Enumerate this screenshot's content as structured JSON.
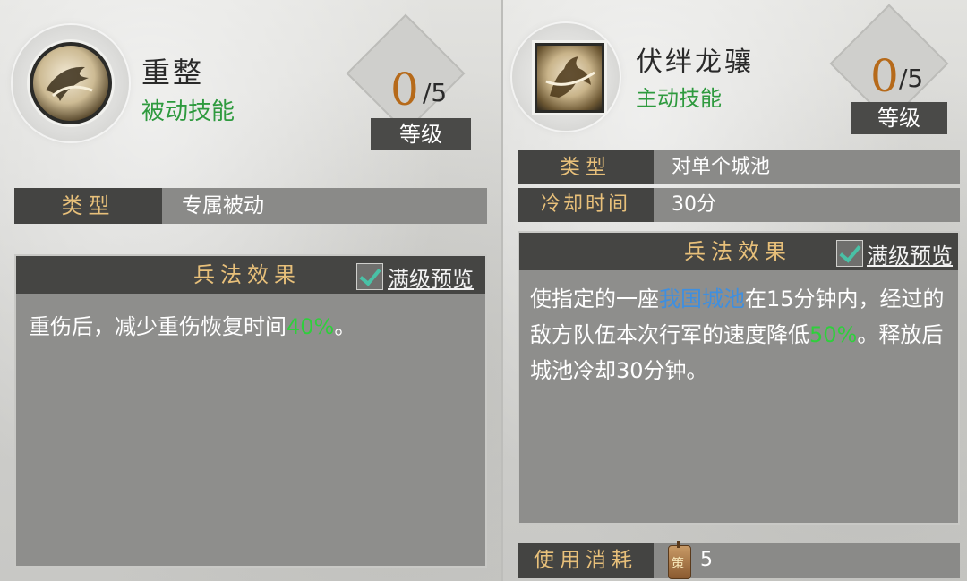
{
  "left": {
    "skill_name": "重整",
    "skill_kind": "被动技能",
    "level": {
      "current": "0",
      "max": "/5",
      "label": "等级"
    },
    "type_row": {
      "label": "类型",
      "value": "专属被动"
    },
    "effect": {
      "title": "兵法效果",
      "preview_label": "满级预览",
      "preview_checked": true,
      "text_before": "重伤后，减少重伤恢复时间",
      "text_highlight": "40%",
      "text_after": "。"
    }
  },
  "right": {
    "skill_name": "伏绊龙骧",
    "skill_kind": "主动技能",
    "level": {
      "current": "0",
      "max": "/5",
      "label": "等级"
    },
    "type_row": {
      "label": "类型",
      "value": "对单个城池"
    },
    "cooldown_row": {
      "label": "冷却时间",
      "value": "30分"
    },
    "effect": {
      "title": "兵法效果",
      "preview_label": "满级预览",
      "preview_checked": true,
      "text_1": "使指定的一座",
      "text_blue": "我国城池",
      "text_2": "在15分钟内，经过的敌方队伍本次行军的速度降低",
      "text_green": "50%",
      "text_3": "。释放后城池冷却30分钟。"
    },
    "cost_row": {
      "label": "使用消耗",
      "token_glyph": "策",
      "value": "5"
    }
  },
  "colors": {
    "passive_green": "#2e9a3e",
    "highlight_green": "#2fcf3c",
    "highlight_blue": "#3f8fdf",
    "level_orange": "#b66a1a",
    "header_gold": "#e8c07a"
  }
}
